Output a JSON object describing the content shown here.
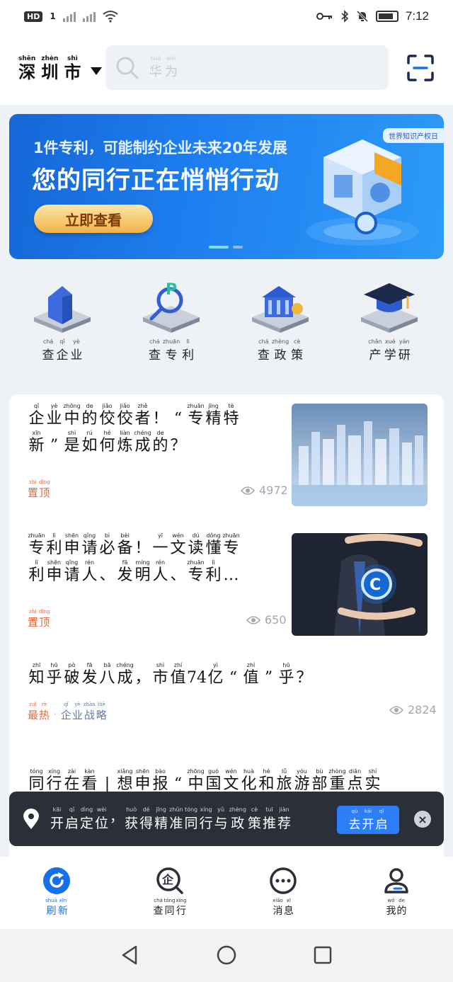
{
  "status_bar": {
    "hd_label": "HD",
    "sim_label": "1",
    "time": "7:12"
  },
  "header": {
    "city": {
      "chars": [
        {
          "py": "shēn",
          "hz": "深"
        },
        {
          "py": "zhèn",
          "hz": "圳"
        },
        {
          "py": "shì",
          "hz": "市"
        }
      ]
    },
    "search": {
      "placeholder_chars": [
        {
          "py": "huá",
          "hz": "华"
        },
        {
          "py": "wéi",
          "hz": "为"
        }
      ]
    }
  },
  "banner": {
    "line1": "1件专利，可能制约企业未来20年发展",
    "line2": "您的同行正在悄悄行动",
    "cta": "立即查看",
    "tag": "世界知识产权日",
    "colors": {
      "bg": "#1e7ff0",
      "cta": "#f2b246"
    }
  },
  "quick_nav": [
    {
      "name": "查企业",
      "chars": [
        {
          "py": "chá",
          "hz": "查"
        },
        {
          "py": "qǐ",
          "hz": "企"
        },
        {
          "py": "yè",
          "hz": "业"
        }
      ]
    },
    {
      "name": "查专利",
      "chars": [
        {
          "py": "chá",
          "hz": "查"
        },
        {
          "py": "zhuān",
          "hz": "专"
        },
        {
          "py": "lì",
          "hz": "利"
        }
      ]
    },
    {
      "name": "查政策",
      "chars": [
        {
          "py": "chá",
          "hz": "查"
        },
        {
          "py": "zhèng",
          "hz": "政"
        },
        {
          "py": "cè",
          "hz": "策"
        }
      ]
    },
    {
      "name": "产学研",
      "chars": [
        {
          "py": "chǎn",
          "hz": "产"
        },
        {
          "py": "xué",
          "hz": "学"
        },
        {
          "py": "yán",
          "hz": "研"
        }
      ]
    }
  ],
  "articles": [
    {
      "lines": [
        [
          {
            "py": "qǐ",
            "hz": "企"
          },
          {
            "py": "yè",
            "hz": "业"
          },
          {
            "py": "zhōng",
            "hz": "中"
          },
          {
            "py": "de",
            "hz": "的"
          },
          {
            "py": "jiǎo",
            "hz": "佼"
          },
          {
            "py": "jiǎo",
            "hz": "佼"
          },
          {
            "py": "zhě",
            "hz": "者"
          },
          {
            "py": "",
            "hz": "！"
          },
          {
            "py": "",
            "hz": "“"
          },
          {
            "py": "zhuān",
            "hz": "专"
          },
          {
            "py": "jīng",
            "hz": "精"
          },
          {
            "py": "tè",
            "hz": "特"
          }
        ],
        [
          {
            "py": "xīn",
            "hz": "新"
          },
          {
            "py": "",
            "hz": "”"
          },
          {
            "py": "shì",
            "hz": "是"
          },
          {
            "py": "rú",
            "hz": "如"
          },
          {
            "py": "hé",
            "hz": "何"
          },
          {
            "py": "liàn",
            "hz": "炼"
          },
          {
            "py": "chéng",
            "hz": "成"
          },
          {
            "py": "de",
            "hz": "的"
          },
          {
            "py": "",
            "hz": "？"
          }
        ]
      ],
      "tags": [
        {
          "style": "red",
          "chars": [
            {
              "py": "zhì",
              "hz": "置"
            },
            {
              "py": "dǐng",
              "hz": "顶"
            }
          ]
        }
      ],
      "views": "4972"
    },
    {
      "lines": [
        [
          {
            "py": "zhuān",
            "hz": "专"
          },
          {
            "py": "lì",
            "hz": "利"
          },
          {
            "py": "shēn",
            "hz": "申"
          },
          {
            "py": "qǐng",
            "hz": "请"
          },
          {
            "py": "bì",
            "hz": "必"
          },
          {
            "py": "bèi",
            "hz": "备"
          },
          {
            "py": "",
            "hz": "！"
          },
          {
            "py": "yī",
            "hz": "一"
          },
          {
            "py": "wén",
            "hz": "文"
          },
          {
            "py": "dú",
            "hz": "读"
          },
          {
            "py": "dǒng",
            "hz": "懂"
          },
          {
            "py": "zhuān",
            "hz": "专"
          }
        ],
        [
          {
            "py": "lì",
            "hz": "利"
          },
          {
            "py": "shēn",
            "hz": "申"
          },
          {
            "py": "qǐng",
            "hz": "请"
          },
          {
            "py": "rén",
            "hz": "人"
          },
          {
            "py": "",
            "hz": "、"
          },
          {
            "py": "fā",
            "hz": "发"
          },
          {
            "py": "míng",
            "hz": "明"
          },
          {
            "py": "rén",
            "hz": "人"
          },
          {
            "py": "",
            "hz": "、"
          },
          {
            "py": "zhuān",
            "hz": "专"
          },
          {
            "py": "lì",
            "hz": "利"
          },
          {
            "py": "",
            "hz": "…"
          }
        ]
      ],
      "tags": [
        {
          "style": "red",
          "chars": [
            {
              "py": "zhì",
              "hz": "置"
            },
            {
              "py": "dǐng",
              "hz": "顶"
            }
          ]
        }
      ],
      "views": "650"
    },
    {
      "lines": [
        [
          {
            "py": "zhī",
            "hz": "知"
          },
          {
            "py": "hū",
            "hz": "乎"
          },
          {
            "py": "pò",
            "hz": "破"
          },
          {
            "py": "fā",
            "hz": "发"
          },
          {
            "py": "bā",
            "hz": "八"
          },
          {
            "py": "chéng",
            "hz": "成"
          },
          {
            "py": "",
            "hz": "，"
          },
          {
            "py": "shì",
            "hz": "市"
          },
          {
            "py": "zhí",
            "hz": "值"
          },
          {
            "py": "",
            "hz": "74"
          },
          {
            "py": "yì",
            "hz": "亿"
          },
          {
            "py": "",
            "hz": "“"
          },
          {
            "py": "zhí",
            "hz": "值"
          },
          {
            "py": "",
            "hz": "”"
          },
          {
            "py": "hū",
            "hz": "乎"
          },
          {
            "py": "",
            "hz": "？"
          }
        ]
      ],
      "tags": [
        {
          "style": "red",
          "chars": [
            {
              "py": "zuì",
              "hz": "最"
            },
            {
              "py": "rè",
              "hz": "热"
            }
          ]
        },
        {
          "style": "blue",
          "chars": [
            {
              "py": "qǐ",
              "hz": "企"
            },
            {
              "py": "yè",
              "hz": "业"
            },
            {
              "py": "zhàn",
              "hz": "战"
            },
            {
              "py": "lüè",
              "hz": "略"
            }
          ]
        }
      ],
      "views": "2824"
    },
    {
      "lines": [
        [
          {
            "py": "tóng",
            "hz": "同"
          },
          {
            "py": "xíng",
            "hz": "行"
          },
          {
            "py": "zài",
            "hz": "在"
          },
          {
            "py": "kàn",
            "hz": "看"
          },
          {
            "py": "",
            "hz": "|"
          },
          {
            "py": "xiǎng",
            "hz": "想"
          },
          {
            "py": "shēn",
            "hz": "申"
          },
          {
            "py": "bào",
            "hz": "报"
          },
          {
            "py": "",
            "hz": "“"
          },
          {
            "py": "zhōng",
            "hz": "中"
          },
          {
            "py": "guó",
            "hz": "国"
          },
          {
            "py": "wén",
            "hz": "文"
          },
          {
            "py": "huà",
            "hz": "化"
          },
          {
            "py": "hé",
            "hz": "和"
          },
          {
            "py": "lǚ",
            "hz": "旅"
          },
          {
            "py": "yóu",
            "hz": "游"
          },
          {
            "py": "bù",
            "hz": "部"
          },
          {
            "py": "zhòng",
            "hz": "重"
          },
          {
            "py": "diǎn",
            "hz": "点"
          },
          {
            "py": "shí",
            "hz": "实"
          }
        ]
      ],
      "tags": [],
      "views": ""
    }
  ],
  "toast": {
    "chars": [
      {
        "py": "kāi",
        "hz": "开"
      },
      {
        "py": "qǐ",
        "hz": "启"
      },
      {
        "py": "dìng",
        "hz": "定"
      },
      {
        "py": "wèi",
        "hz": "位"
      },
      {
        "py": "",
        "hz": "，"
      },
      {
        "py": "huò",
        "hz": "获"
      },
      {
        "py": "dé",
        "hz": "得"
      },
      {
        "py": "jīng",
        "hz": "精"
      },
      {
        "py": "zhǔn",
        "hz": "准"
      },
      {
        "py": "tóng",
        "hz": "同"
      },
      {
        "py": "xíng",
        "hz": "行"
      },
      {
        "py": "yǔ",
        "hz": "与"
      },
      {
        "py": "zhèng",
        "hz": "政"
      },
      {
        "py": "cè",
        "hz": "策"
      },
      {
        "py": "tuī",
        "hz": "推"
      },
      {
        "py": "jiàn",
        "hz": "荐"
      }
    ],
    "button_chars": [
      {
        "py": "qù",
        "hz": "去"
      },
      {
        "py": "kāi",
        "hz": "开"
      },
      {
        "py": "qǐ",
        "hz": "启"
      }
    ],
    "close_glyph": "×"
  },
  "tabs": [
    {
      "name": "刷新",
      "active": true,
      "chars": [
        {
          "py": "shuā",
          "hz": "刷"
        },
        {
          "py": "xīn",
          "hz": "新"
        }
      ]
    },
    {
      "name": "查同行",
      "active": false,
      "chars": [
        {
          "py": "chá",
          "hz": "查"
        },
        {
          "py": "tóng",
          "hz": "同"
        },
        {
          "py": "xíng",
          "hz": "行"
        }
      ]
    },
    {
      "name": "消息",
      "active": false,
      "chars": [
        {
          "py": "xiāo",
          "hz": "消"
        },
        {
          "py": "xī",
          "hz": "息"
        }
      ]
    },
    {
      "name": "我的",
      "active": false,
      "chars": [
        {
          "py": "wǒ",
          "hz": "我"
        },
        {
          "py": "de",
          "hz": "的"
        }
      ]
    }
  ],
  "colors": {
    "accent": "#1570ef",
    "tag_red": "#e06a3c",
    "tag_blue": "#5e77b5",
    "toast_bg": "#2a2f38"
  }
}
